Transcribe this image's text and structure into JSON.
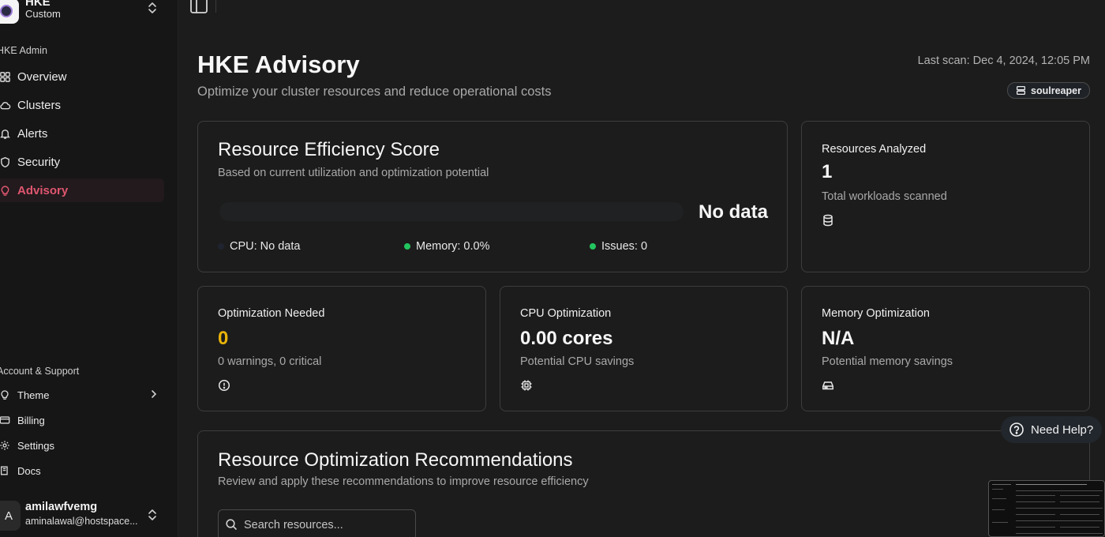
{
  "sidebar": {
    "org": {
      "name": "HKE",
      "plan": "Custom"
    },
    "admin_label": "HKE Admin",
    "nav": [
      {
        "label": "Overview",
        "icon": "grid-icon"
      },
      {
        "label": "Clusters",
        "icon": "cloud-icon"
      },
      {
        "label": "Alerts",
        "icon": "bell-icon"
      },
      {
        "label": "Security",
        "icon": "shield-icon"
      },
      {
        "label": "Advisory",
        "icon": "lightbulb-icon",
        "active": true
      }
    ],
    "account_label": "Account & Support",
    "account_items": [
      {
        "label": "Theme",
        "icon": "lightbulb-icon"
      },
      {
        "label": "Billing",
        "icon": "card-icon"
      },
      {
        "label": "Settings",
        "icon": "gear-icon"
      },
      {
        "label": "Docs",
        "icon": "book-icon"
      }
    ],
    "user": {
      "initial": "A",
      "name": "amilawfvemg",
      "email": "aminalawal@hostspace..."
    }
  },
  "header": {
    "title": "HKE Advisory",
    "subtitle": "Optimize your cluster resources and reduce operational costs",
    "last_scan": "Last scan: Dec 4, 2024, 12:05 PM",
    "cluster": "soulreaper"
  },
  "efficiency": {
    "title": "Resource Efficiency Score",
    "subtitle": "Based on current utilization and optimization potential",
    "score": "No data",
    "legend": [
      {
        "label": "CPU: No data",
        "color": "#1f2430"
      },
      {
        "label": "Memory: 0.0%",
        "color": "#22c55e"
      },
      {
        "label": "Issues: 0",
        "color": "#22c55e"
      }
    ]
  },
  "stats": {
    "resources": {
      "label": "Resources Analyzed",
      "value": "1",
      "sub": "Total workloads scanned",
      "icon": "database-icon"
    },
    "optimization": {
      "label": "Optimization Needed",
      "value": "0",
      "sub": "0 warnings, 0 critical",
      "icon": "alert-circle-icon",
      "value_color": "#eab308"
    },
    "cpu": {
      "label": "CPU Optimization",
      "value": "0.00 cores",
      "sub": "Potential CPU savings",
      "icon": "cpu-icon"
    },
    "memory": {
      "label": "Memory Optimization",
      "value": "N/A",
      "sub": "Potential memory savings",
      "icon": "hard-drive-icon"
    }
  },
  "recommendations": {
    "title": "Resource Optimization Recommendations",
    "subtitle": "Review and apply these recommendations to improve resource efficiency",
    "search_placeholder": "Search resources..."
  },
  "help": {
    "label": "Need Help?"
  }
}
